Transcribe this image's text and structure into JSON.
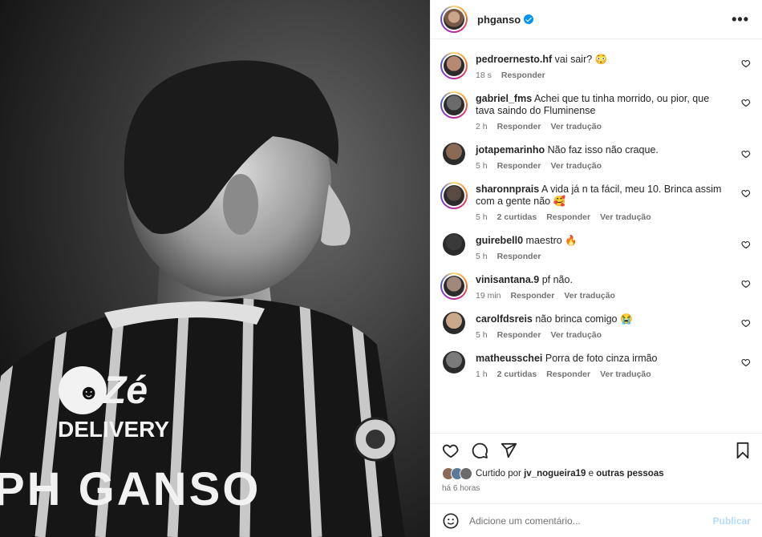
{
  "post": {
    "username": "phganso",
    "verified": true
  },
  "comments": [
    {
      "user": "pedroernesto.hf",
      "text": "vai sair? 😳",
      "time": "18 s",
      "curtidas": "",
      "reply": "Responder",
      "translate": "",
      "ring": true,
      "color": "#b68a72"
    },
    {
      "user": "gabriel_fms",
      "text": "Achei que tu tinha morrido, ou pior, que tava saindo do Fluminense",
      "time": "2 h",
      "curtidas": "",
      "reply": "Responder",
      "translate": "Ver tradução",
      "ring": true,
      "color": "#6b6b6b"
    },
    {
      "user": "jotapemarinho",
      "text": "Não faz isso não craque.",
      "time": "5 h",
      "curtidas": "",
      "reply": "Responder",
      "translate": "Ver tradução",
      "ring": false,
      "color": "#8a6a55"
    },
    {
      "user": "sharonnprais",
      "text": "A vida já n ta fácil, meu 10. Brinca assim com a gente não 🥰",
      "time": "5 h",
      "curtidas": "2 curtidas",
      "reply": "Responder",
      "translate": "Ver tradução",
      "ring": true,
      "color": "#5a4a44"
    },
    {
      "user": "guirebell0",
      "text": "maestro 🔥",
      "time": "5 h",
      "curtidas": "",
      "reply": "Responder",
      "translate": "",
      "ring": false,
      "color": "#3a3a3a"
    },
    {
      "user": "vinisantana.9",
      "text": "pf não.",
      "time": "19 min",
      "curtidas": "",
      "reply": "Responder",
      "translate": "Ver tradução",
      "ring": true,
      "color": "#a0887a"
    },
    {
      "user": "carolfdsreis",
      "text": "não brinca comigo 😭",
      "time": "5 h",
      "curtidas": "",
      "reply": "Responder",
      "translate": "Ver tradução",
      "ring": false,
      "color": "#c9a98a"
    },
    {
      "user": "matheusschei",
      "text": "Porra de foto cinza irmão",
      "time": "1 h",
      "curtidas": "2 curtidas",
      "reply": "Responder",
      "translate": "Ver tradução",
      "ring": false,
      "color": "#7a7a7a"
    }
  ],
  "likes": {
    "prefix": "Curtido por",
    "user": "jv_nogueira19",
    "connector": "e",
    "others": "outras pessoas"
  },
  "timestamp": "há 6 horas",
  "add_comment": {
    "placeholder": "Adicione um comentário...",
    "publish": "Publicar"
  },
  "jersey": {
    "sponsor_top": "Zé",
    "sponsor_bottom": "DELIVERY",
    "name": "PH GANSO"
  }
}
